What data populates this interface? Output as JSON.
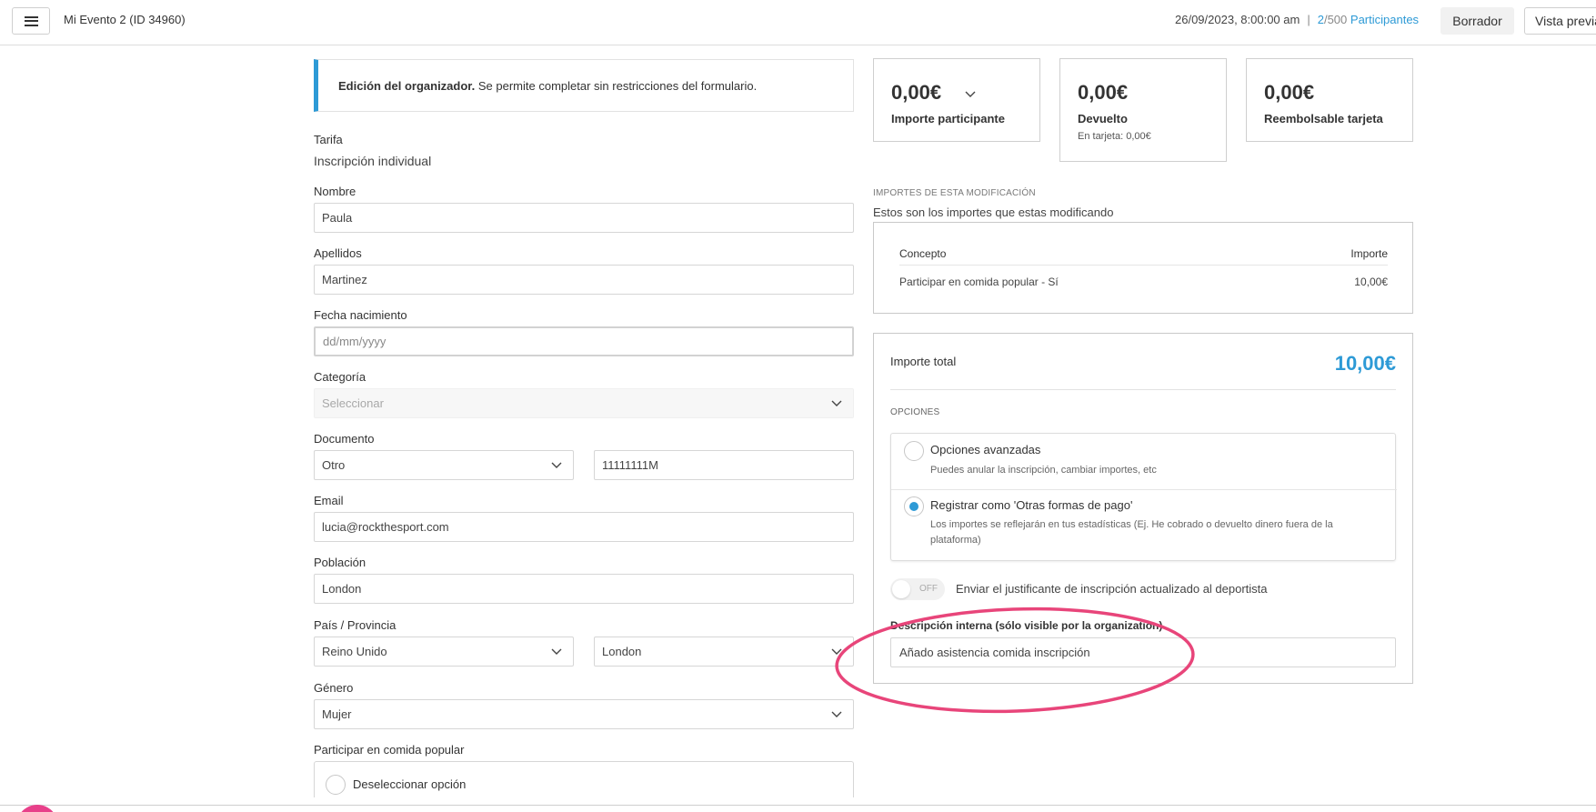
{
  "topbar": {
    "event_title": "Mi Evento 2 (ID 34960)",
    "datetime": "26/09/2023, 8:00:00 am",
    "separator": "|",
    "participants_count": "2",
    "participants_total": "/500",
    "participants_label": "Participantes",
    "draft_label": "Borrador",
    "preview_label": "Vista previa"
  },
  "notice": {
    "bold": "Edición del organizador.",
    "text": " Se permite completar sin restricciones del formulario."
  },
  "form": {
    "tarifa_label": "Tarifa",
    "tarifa_value": "Inscripción individual",
    "nombre_label": "Nombre",
    "nombre_value": "Paula",
    "apellidos_label": "Apellidos",
    "apellidos_value": "Martinez",
    "fecha_label": "Fecha nacimiento",
    "fecha_placeholder": "dd/mm/yyyy",
    "categoria_label": "Categoría",
    "categoria_value": "Seleccionar",
    "documento_label": "Documento",
    "documento_type": "Otro",
    "documento_number": "11111111M",
    "email_label": "Email",
    "email_value": "lucia@rockthesport.com",
    "poblacion_label": "Población",
    "poblacion_value": "London",
    "pais_label": "País / Provincia",
    "pais_value": "Reino Unido",
    "provincia_value": "London",
    "genero_label": "Género",
    "genero_value": "Mujer",
    "comida_label": "Participar en comida popular",
    "comida_option": "Deseleccionar opción"
  },
  "stats": {
    "participante_amount": "0,00€",
    "participante_label": "Importe participante",
    "devuelto_amount": "0,00€",
    "devuelto_label": "Devuelto",
    "devuelto_sub": "En tarjeta: 0,00€",
    "reembolsable_amount": "0,00€",
    "reembolsable_label": "Reembolsable tarjeta"
  },
  "modification": {
    "caption": "IMPORTES DE ESTA MODIFICACIÓN",
    "subtitle": "Estos son los importes que estas modificando",
    "col_concepto": "Concepto",
    "col_importe": "Importe",
    "rows": [
      {
        "concepto": "Participar en comida popular - Sí",
        "importe": "10,00€"
      }
    ]
  },
  "total": {
    "label": "Importe total",
    "amount": "10,00€",
    "opciones_caption": "OPCIONES",
    "options": [
      {
        "title": "Opciones avanzadas",
        "desc": "Puedes anular la inscripción, cambiar importes, etc",
        "selected": false
      },
      {
        "title": "Registrar como 'Otras formas de pago'",
        "desc": "Los importes se reflejarán en tus estadísticas (Ej. He cobrado o devuelto dinero fuera de la plataforma)",
        "selected": true
      }
    ],
    "toggle_state": "OFF",
    "toggle_label": "Enviar el justificante de inscripción actualizado al deportista",
    "desc_label": "Descripción interna (sólo visible por la organization)",
    "desc_value": "Añado asistencia comida inscripción"
  },
  "colors": {
    "accent": "#2d9ad6",
    "annotation": "#e8457a"
  }
}
